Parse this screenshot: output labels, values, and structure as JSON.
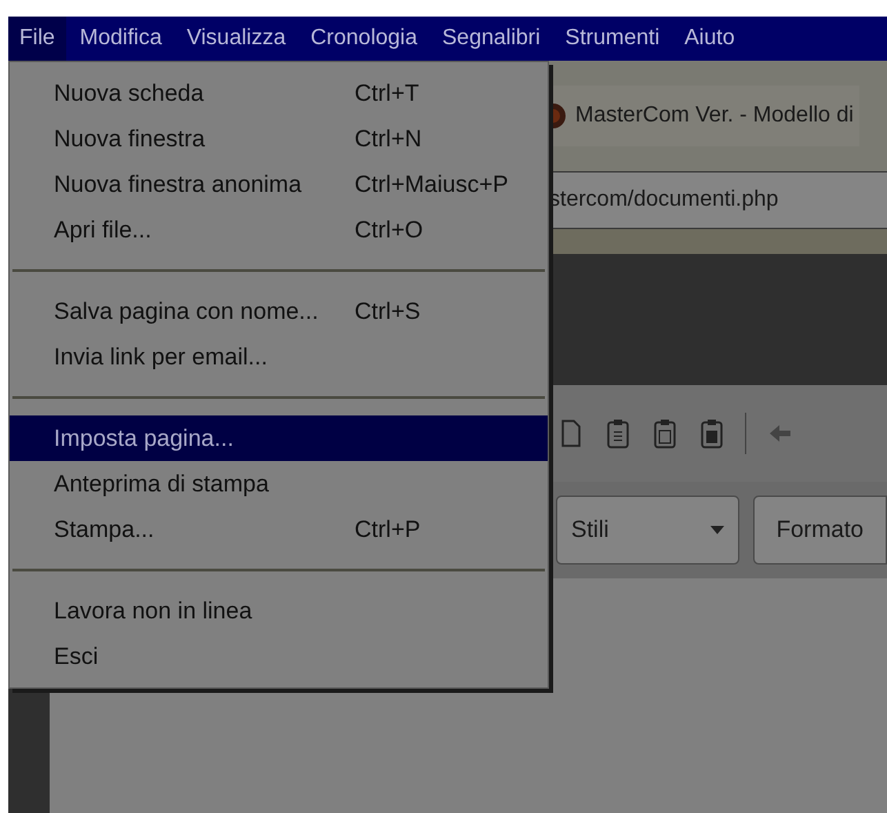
{
  "menubar": [
    {
      "label": "File",
      "selected": true
    },
    {
      "label": "Modifica",
      "selected": false
    },
    {
      "label": "Visualizza",
      "selected": false
    },
    {
      "label": "Cronologia",
      "selected": false
    },
    {
      "label": "Segnalibri",
      "selected": false
    },
    {
      "label": "Strumenti",
      "selected": false
    },
    {
      "label": "Aiuto",
      "selected": false
    }
  ],
  "file_menu": [
    {
      "kind": "item",
      "label": "Nuova scheda",
      "shortcut": "Ctrl+T",
      "selected": false
    },
    {
      "kind": "item",
      "label": "Nuova finestra",
      "shortcut": "Ctrl+N",
      "selected": false
    },
    {
      "kind": "item",
      "label": "Nuova finestra anonima",
      "shortcut": "Ctrl+Maiusc+P",
      "selected": false
    },
    {
      "kind": "item",
      "label": "Apri file...",
      "shortcut": "Ctrl+O",
      "selected": false
    },
    {
      "kind": "separator"
    },
    {
      "kind": "item",
      "label": "Salva pagina con nome...",
      "shortcut": "Ctrl+S",
      "selected": false
    },
    {
      "kind": "item",
      "label": "Invia link per email...",
      "selected": false
    },
    {
      "kind": "separator"
    },
    {
      "kind": "item",
      "label": "Imposta pagina...",
      "selected": true
    },
    {
      "kind": "item",
      "label": "Anteprima di stampa",
      "selected": false
    },
    {
      "kind": "item",
      "label": "Stampa...",
      "shortcut": "Ctrl+P",
      "selected": false
    },
    {
      "kind": "separator"
    },
    {
      "kind": "item",
      "label": "Lavora non in linea",
      "selected": false
    },
    {
      "kind": "item",
      "label": "Esci",
      "selected": false
    }
  ],
  "tab": {
    "title": "MasterCom Ver. - Modello di"
  },
  "address_bar": {
    "value": "stercom/documenti.php"
  },
  "editor_toolbar": {
    "styles_dropdown": "Stili",
    "format_button": "Formato"
  }
}
